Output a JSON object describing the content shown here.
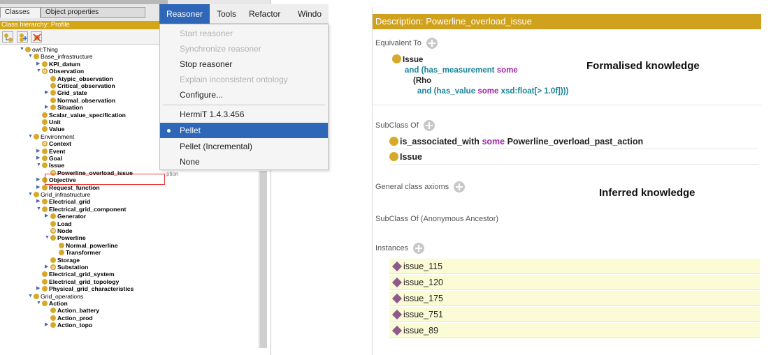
{
  "left": {
    "tabs": [
      "Classes",
      "Object properties"
    ],
    "hierarchy_title": "Class hierarchy: Profile",
    "tree": [
      {
        "label": "owl:Thing",
        "depth": 0,
        "arrow": "down",
        "bold": false
      },
      {
        "label": "Base_infrastructure",
        "depth": 1,
        "arrow": "down",
        "bold": false
      },
      {
        "label": "KPI_datum",
        "depth": 2,
        "arrow": "right",
        "bold": true
      },
      {
        "label": "Observation",
        "depth": 2,
        "arrow": "down",
        "bold": true,
        "eq": true
      },
      {
        "label": "Atypic_observation",
        "depth": 3,
        "arrow": "",
        "bold": true
      },
      {
        "label": "Critical_observation",
        "depth": 3,
        "arrow": "",
        "bold": true
      },
      {
        "label": "Grid_state",
        "depth": 3,
        "arrow": "right",
        "bold": true
      },
      {
        "label": "Normal_observation",
        "depth": 3,
        "arrow": "",
        "bold": true
      },
      {
        "label": "Situation",
        "depth": 3,
        "arrow": "right",
        "bold": true
      },
      {
        "label": "Scalar_value_specification",
        "depth": 2,
        "arrow": "",
        "bold": true
      },
      {
        "label": "Unit",
        "depth": 2,
        "arrow": "",
        "bold": true
      },
      {
        "label": "Value",
        "depth": 2,
        "arrow": "",
        "bold": true
      },
      {
        "label": "Environment",
        "depth": 1,
        "arrow": "down",
        "bold": false
      },
      {
        "label": "Context",
        "depth": 2,
        "arrow": "",
        "bold": true,
        "eq": true
      },
      {
        "label": "Event",
        "depth": 2,
        "arrow": "right",
        "bold": true
      },
      {
        "label": "Goal",
        "depth": 2,
        "arrow": "right",
        "bold": true
      },
      {
        "label": "Issue",
        "depth": 2,
        "arrow": "down",
        "bold": true
      },
      {
        "label": "Powerline_overload_issue",
        "depth": 3,
        "arrow": "",
        "bold": true,
        "eq": true
      },
      {
        "label": "Objective",
        "depth": 2,
        "arrow": "right",
        "bold": true
      },
      {
        "label": "Request_function",
        "depth": 2,
        "arrow": "right",
        "bold": true
      },
      {
        "label": "Grid_infrastructure",
        "depth": 1,
        "arrow": "down",
        "bold": false
      },
      {
        "label": "Electrical_grid",
        "depth": 2,
        "arrow": "right",
        "bold": true
      },
      {
        "label": "Electrical_grid_component",
        "depth": 2,
        "arrow": "down",
        "bold": true
      },
      {
        "label": "Generator",
        "depth": 3,
        "arrow": "right",
        "bold": true
      },
      {
        "label": "Load",
        "depth": 3,
        "arrow": "",
        "bold": true
      },
      {
        "label": "Node",
        "depth": 3,
        "arrow": "",
        "bold": true,
        "eq": true
      },
      {
        "label": "Powerline",
        "depth": 3,
        "arrow": "down",
        "bold": true
      },
      {
        "label": "Normal_powerline",
        "depth": 4,
        "arrow": "",
        "bold": true
      },
      {
        "label": "Transformer",
        "depth": 4,
        "arrow": "",
        "bold": true
      },
      {
        "label": "Storage",
        "depth": 3,
        "arrow": "",
        "bold": true
      },
      {
        "label": "Substation",
        "depth": 3,
        "arrow": "right",
        "bold": true,
        "eq": true
      },
      {
        "label": "Electrical_grid_system",
        "depth": 2,
        "arrow": "",
        "bold": true
      },
      {
        "label": "Electrical_grid_topology",
        "depth": 2,
        "arrow": "",
        "bold": true
      },
      {
        "label": "Physical_grid_characteristics",
        "depth": 2,
        "arrow": "right",
        "bold": true
      },
      {
        "label": "Grid_operations",
        "depth": 1,
        "arrow": "down",
        "bold": false
      },
      {
        "label": "Action",
        "depth": 2,
        "arrow": "down",
        "bold": true
      },
      {
        "label": "Action_battery",
        "depth": 3,
        "arrow": "",
        "bold": true
      },
      {
        "label": "Action_prod",
        "depth": 3,
        "arrow": "",
        "bold": true
      },
      {
        "label": "Action_topo",
        "depth": 3,
        "arrow": "right",
        "bold": true
      }
    ],
    "cut_text": "ption"
  },
  "menu": {
    "bar": [
      "Reasoner",
      "Tools",
      "Refactor",
      "Windo"
    ],
    "items": [
      {
        "label": "Start reasoner",
        "state": "disabled"
      },
      {
        "label": "Synchronize reasoner",
        "state": "disabled"
      },
      {
        "label": "Stop reasoner",
        "state": "normal"
      },
      {
        "label": "Explain inconsistent ontology",
        "state": "disabled"
      },
      {
        "label": "Configure...",
        "state": "normal"
      },
      {
        "label": "HermiT 1.4.3.456",
        "state": "normal"
      },
      {
        "label": "Pellet",
        "state": "selected"
      },
      {
        "label": "Pellet (Incremental)",
        "state": "normal"
      },
      {
        "label": "None",
        "state": "normal"
      }
    ]
  },
  "right": {
    "header": "Description: Powerline_overload_issue",
    "sections": {
      "equivalent_to": "Equivalent To",
      "subclass_of": "SubClass Of",
      "general_axioms": "General class axioms",
      "anon_ancestor": "SubClass Of (Anonymous Ancestor)",
      "instances": "Instances"
    },
    "equivalent": {
      "class": "Issue",
      "and1": "and",
      "prop1": "(has_measurement",
      "some1": "some",
      "rho": "(Rho",
      "and2": "and",
      "prop2": "(has_value",
      "some2": "some",
      "datatype": "xsd:float[> 1.0f]",
      "close": ")))"
    },
    "subclass": {
      "axiom1_prop": "is_associated_with",
      "axiom1_some": "some",
      "axiom1_class": "Powerline_overload_past_action",
      "axiom2": "Issue"
    },
    "instances": [
      "issue_115",
      "issue_120",
      "issue_175",
      "issue_751",
      "issue_89"
    ],
    "annotations": {
      "formalised": "Formalised knowledge",
      "inferred": "Inferred knowledge"
    }
  },
  "colors": {
    "accent_gold": "#d0a11c",
    "menu_blue": "#2f67b8",
    "keyword_purple": "#a127a8",
    "teal": "#19849a",
    "instance_bg": "#fbfbd5"
  }
}
